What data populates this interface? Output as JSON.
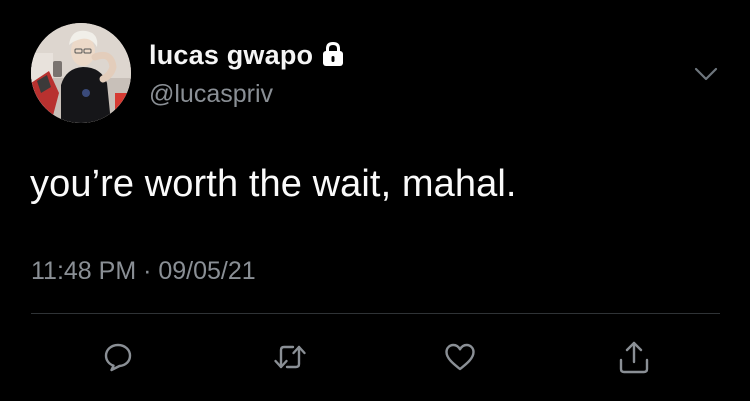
{
  "tweet": {
    "author": {
      "display_name": "lucas gwapo",
      "handle": "@lucaspriv",
      "protected_icon": "lock-icon"
    },
    "text": "you’re worth the wait, mahal.",
    "time": "11:48 PM",
    "separator": " · ",
    "date": "09/05/21",
    "menu_icon": "chevron-down-icon",
    "actions": [
      {
        "icon": "reply-icon"
      },
      {
        "icon": "retweet-icon"
      },
      {
        "icon": "like-icon"
      },
      {
        "icon": "share-icon"
      }
    ]
  },
  "colors": {
    "background": "#000000",
    "text_primary": "#fafafa",
    "text_secondary": "#8a8f95",
    "divider": "#2f3336"
  }
}
